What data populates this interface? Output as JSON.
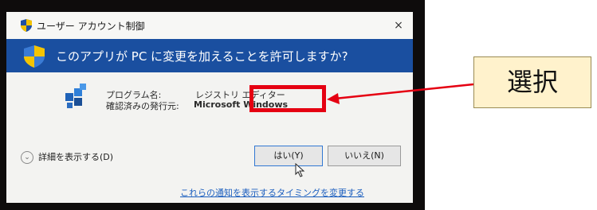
{
  "dialog": {
    "title": "ユーザー アカウント制御",
    "close_glyph": "×",
    "question": "このアプリが PC に変更を加えることを許可しますか?",
    "program_name_label": "プログラム名:",
    "program_name_value": "レジストリ エディター",
    "publisher_label": "確認済みの発行元:",
    "publisher_value": "Microsoft Windows",
    "details_label": "詳細を表示する(D)",
    "details_chevron": "⌄",
    "yes_label": "はい(Y)",
    "no_label": "いいえ(N)",
    "notification_link": "これらの通知を表示するタイミングを変更する"
  },
  "annotation": {
    "callout_text": "選択",
    "highlight_color": "#e50012",
    "callout_bg": "#fff2cc"
  },
  "colors": {
    "banner": "#1a4fa0",
    "link": "#1c5fbf"
  },
  "icons": [
    "uac-shield-icon",
    "uac-shield-large-icon",
    "registry-editor-icon",
    "chevron-down-icon",
    "mouse-cursor-icon",
    "close-icon"
  ]
}
